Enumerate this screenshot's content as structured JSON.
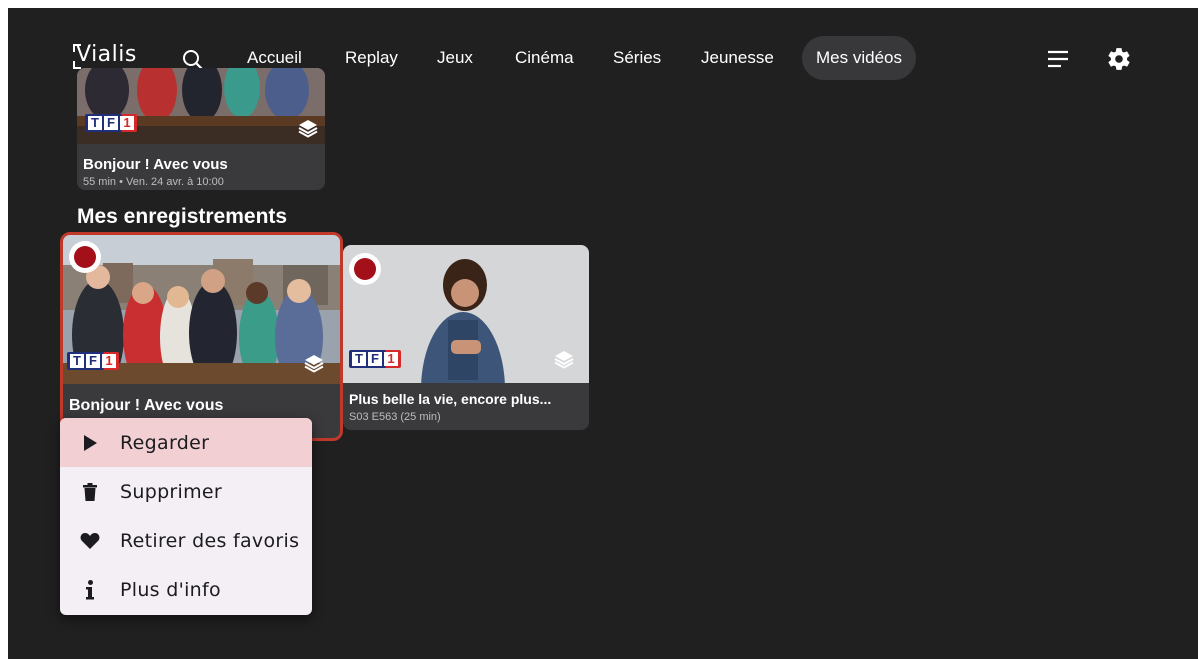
{
  "app": {
    "logo": "Vialis"
  },
  "nav": {
    "items": [
      {
        "label": "Accueil",
        "active": false
      },
      {
        "label": "Replay",
        "active": false
      },
      {
        "label": "Jeux",
        "active": false
      },
      {
        "label": "Cinéma",
        "active": false
      },
      {
        "label": "Séries",
        "active": false
      },
      {
        "label": "Jeunesse",
        "active": false
      },
      {
        "label": "Mes vidéos",
        "active": true
      }
    ]
  },
  "top_card": {
    "title": "Bonjour ! Avec vous",
    "subtitle": "55 min • Ven. 24 avr. à 10:00",
    "channel": "TF1"
  },
  "recordings": {
    "section_title": "Mes enregistrements",
    "cards": [
      {
        "title": "Bonjour ! Avec vous",
        "subtitle": "",
        "channel": "TF1",
        "focused": true
      },
      {
        "title": "Plus belle la vie, encore plus...",
        "subtitle": "S03 E563 (25 min)",
        "channel": "TF1",
        "focused": false
      }
    ]
  },
  "context_menu": {
    "items": [
      {
        "label": "Regarder",
        "icon": "play-icon",
        "highlighted": true
      },
      {
        "label": "Supprimer",
        "icon": "trash-icon",
        "highlighted": false
      },
      {
        "label": "Retirer des favoris",
        "icon": "heart-icon",
        "highlighted": false
      },
      {
        "label": "Plus d'info",
        "icon": "info-icon",
        "highlighted": false
      }
    ]
  },
  "colors": {
    "background": "#202021",
    "card": "#3a3a3d",
    "focus_border": "#c0392b",
    "record_red": "#a3101a",
    "menu_bg": "#f4eff5",
    "menu_highlight": "#f1cfd3"
  }
}
